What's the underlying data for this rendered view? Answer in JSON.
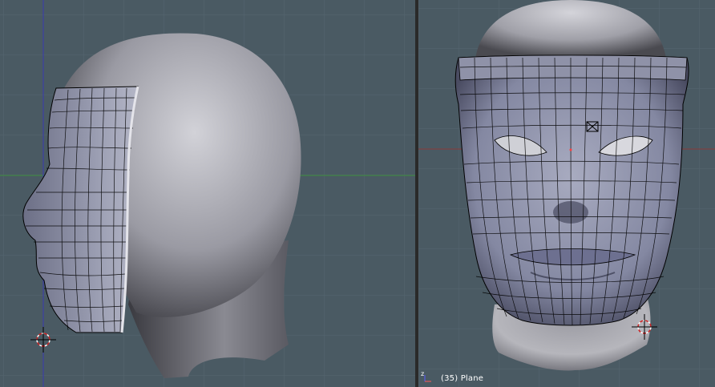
{
  "viewports": {
    "left": {
      "view": "side"
    },
    "right": {
      "view": "front",
      "status_text": "(35) Plane",
      "axis_label": "z"
    }
  },
  "colors": {
    "background": "#4a5a63",
    "grid": "#556670",
    "wire": "#000000",
    "head_light": "#c9c9cf",
    "head_dark": "#3a3a40",
    "x_axis": "#8b3a3a",
    "y_axis": "#3a8b3a",
    "z_axis": "#3a3ab0"
  }
}
